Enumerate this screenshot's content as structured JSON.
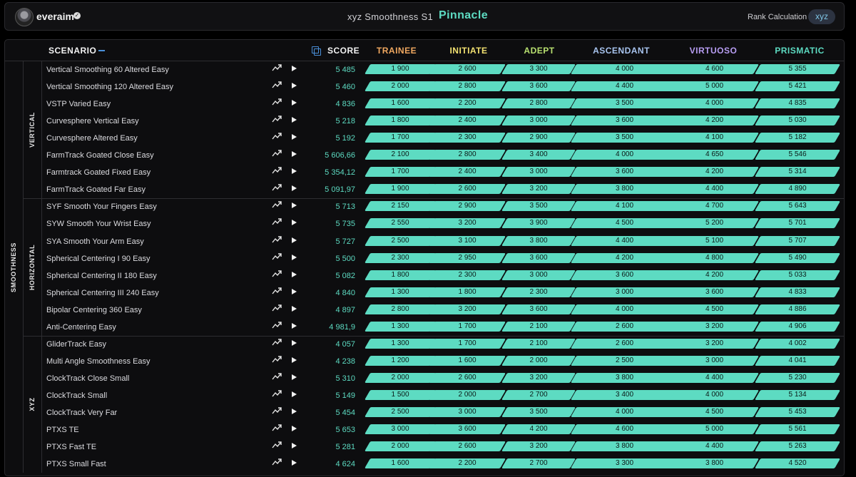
{
  "header": {
    "username": "everaim",
    "title": "xyz Smoothness S1",
    "rank": "Pinnacle",
    "rank_calc_label": "Rank Calculation",
    "rank_calc_value": "xyz"
  },
  "table": {
    "scenario_header": "SCENARIO",
    "score_header": "SCORE",
    "ranks": [
      {
        "name": "TRAINEE",
        "color": "#f0a860"
      },
      {
        "name": "INITIATE",
        "color": "#f1e070"
      },
      {
        "name": "ADEPT",
        "color": "#b8e070"
      },
      {
        "name": "ASCENDANT",
        "color": "#a8c4ef"
      },
      {
        "name": "VIRTUOSO",
        "color": "#b79df2"
      },
      {
        "name": "PRISMATIC",
        "color": "#5ddbc2"
      }
    ],
    "category": "SMOOTHNESS",
    "groups": [
      {
        "label": "VERTICAL",
        "rows": [
          {
            "name": "Vertical Smoothing 60 Altered Easy",
            "score": "5 485",
            "thresholds": [
              "1 900",
              "2 600",
              "3 300",
              "4 000",
              "4 600",
              "5 355"
            ]
          },
          {
            "name": "Vertical Smoothing 120 Altered Easy",
            "score": "5 460",
            "thresholds": [
              "2 000",
              "2 800",
              "3 600",
              "4 400",
              "5 000",
              "5 421"
            ]
          },
          {
            "name": "VSTP Varied Easy",
            "score": "4 836",
            "thresholds": [
              "1 600",
              "2 200",
              "2 800",
              "3 500",
              "4 000",
              "4 835"
            ]
          },
          {
            "name": "Curvesphere Vertical Easy",
            "score": "5 218",
            "thresholds": [
              "1 800",
              "2 400",
              "3 000",
              "3 600",
              "4 200",
              "5 030"
            ]
          },
          {
            "name": "Curvesphere Altered Easy",
            "score": "5 192",
            "thresholds": [
              "1 700",
              "2 300",
              "2 900",
              "3 500",
              "4 100",
              "5 182"
            ]
          },
          {
            "name": "FarmTrack Goated Close Easy",
            "score": "5 606,66",
            "thresholds": [
              "2 100",
              "2 800",
              "3 400",
              "4 000",
              "4 650",
              "5 546"
            ]
          },
          {
            "name": "Farmtrack Goated Fixed Easy",
            "score": "5 354,12",
            "thresholds": [
              "1 700",
              "2 400",
              "3 000",
              "3 600",
              "4 200",
              "5 314"
            ]
          },
          {
            "name": "FarmTrack Goated Far Easy",
            "score": "5 091,97",
            "thresholds": [
              "1 900",
              "2 600",
              "3 200",
              "3 800",
              "4 400",
              "4 890"
            ]
          }
        ]
      },
      {
        "label": "HORIZONTAL",
        "rows": [
          {
            "name": "SYF Smooth Your Fingers Easy",
            "score": "5 713",
            "thresholds": [
              "2 150",
              "2 900",
              "3 500",
              "4 100",
              "4 700",
              "5 643"
            ]
          },
          {
            "name": "SYW Smooth Your Wrist Easy",
            "score": "5 735",
            "thresholds": [
              "2 550",
              "3 200",
              "3 900",
              "4 500",
              "5 200",
              "5 701"
            ]
          },
          {
            "name": "SYA Smooth Your Arm Easy",
            "score": "5 727",
            "thresholds": [
              "2 500",
              "3 100",
              "3 800",
              "4 400",
              "5 100",
              "5 707"
            ]
          },
          {
            "name": "Spherical Centering I 90 Easy",
            "score": "5 500",
            "thresholds": [
              "2 300",
              "2 950",
              "3 600",
              "4 200",
              "4 800",
              "5 490"
            ]
          },
          {
            "name": "Spherical Centering II 180 Easy",
            "score": "5 082",
            "thresholds": [
              "1 800",
              "2 300",
              "3 000",
              "3 600",
              "4 200",
              "5 033"
            ]
          },
          {
            "name": "Spherical Centering III 240 Easy",
            "score": "4 840",
            "thresholds": [
              "1 300",
              "1 800",
              "2 300",
              "3 000",
              "3 600",
              "4 833"
            ]
          },
          {
            "name": "Bipolar Centering 360 Easy",
            "score": "4 897",
            "thresholds": [
              "2 800",
              "3 200",
              "3 600",
              "4 000",
              "4 500",
              "4 886"
            ]
          },
          {
            "name": "Anti-Centering Easy",
            "score": "4 981,9",
            "thresholds": [
              "1 300",
              "1 700",
              "2 100",
              "2 600",
              "3 200",
              "4 906"
            ]
          }
        ]
      },
      {
        "label": "XYZ",
        "rows": [
          {
            "name": "GliderTrack Easy",
            "score": "4 057",
            "thresholds": [
              "1 300",
              "1 700",
              "2 100",
              "2 600",
              "3 200",
              "4 002"
            ]
          },
          {
            "name": "Multi Angle Smoothness Easy",
            "score": "4 238",
            "thresholds": [
              "1 200",
              "1 600",
              "2 000",
              "2 500",
              "3 000",
              "4 041"
            ]
          },
          {
            "name": "ClockTrack Close Small",
            "score": "5 310",
            "thresholds": [
              "2 000",
              "2 600",
              "3 200",
              "3 800",
              "4 400",
              "5 230"
            ]
          },
          {
            "name": "ClockTrack Small",
            "score": "5 149",
            "thresholds": [
              "1 500",
              "2 000",
              "2 700",
              "3 400",
              "4 000",
              "5 134"
            ]
          },
          {
            "name": "ClockTrack Very Far",
            "score": "5 454",
            "thresholds": [
              "2 500",
              "3 000",
              "3 500",
              "4 000",
              "4 500",
              "5 453"
            ]
          },
          {
            "name": "PTXS TE",
            "score": "5 653",
            "thresholds": [
              "3 000",
              "3 600",
              "4 200",
              "4 600",
              "5 000",
              "5 561"
            ]
          },
          {
            "name": "PTXS Fast TE",
            "score": "5 281",
            "thresholds": [
              "2 000",
              "2 600",
              "3 200",
              "3 800",
              "4 400",
              "5 263"
            ]
          },
          {
            "name": "PTXS Small Fast",
            "score": "4 624",
            "thresholds": [
              "1 600",
              "2 200",
              "2 700",
              "3 300",
              "3 800",
              "4 520"
            ]
          }
        ]
      }
    ]
  }
}
